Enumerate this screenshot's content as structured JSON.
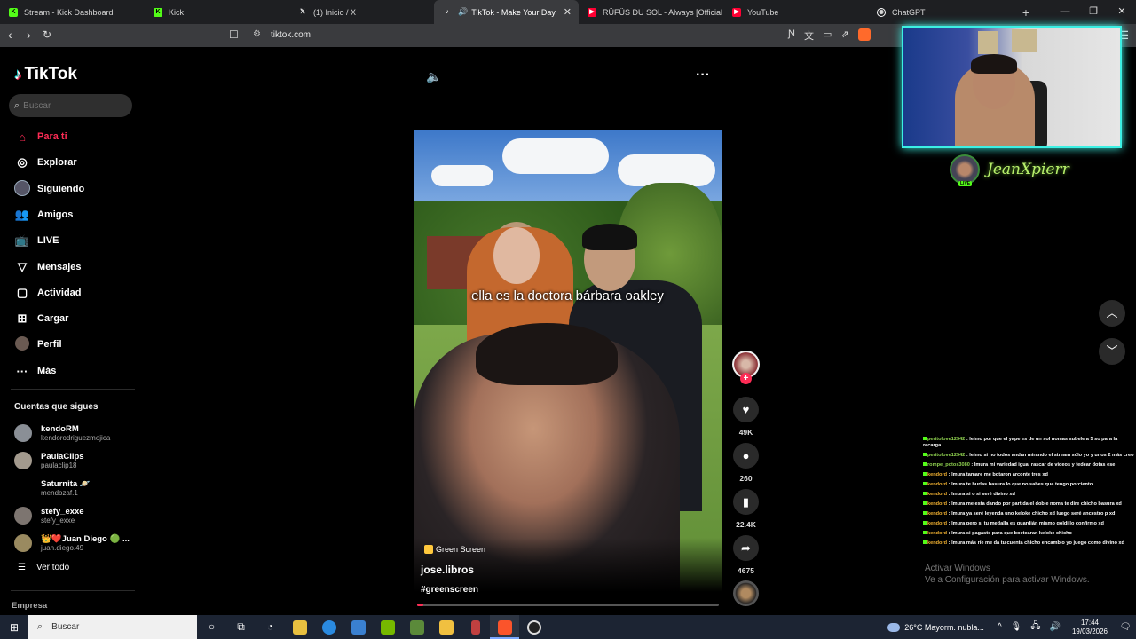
{
  "browser": {
    "tabs": [
      {
        "label": "Stream - Kick Dashboard",
        "icon": "kick-icon",
        "color": "#53fc18"
      },
      {
        "label": "Kick",
        "icon": "kick-icon",
        "color": "#53fc18"
      },
      {
        "label": "(1) Inicio / X",
        "icon": "x-icon",
        "color": "#ffffff"
      },
      {
        "label": "TikTok - Make Your Day",
        "icon": "tiktok-icon",
        "color": "#ffffff",
        "active": true
      },
      {
        "label": "RÜFÜS DU SOL - Always [Official Au",
        "icon": "youtube-icon",
        "color": "#ff0033"
      },
      {
        "label": "YouTube",
        "icon": "youtube-icon",
        "color": "#ff0033"
      },
      {
        "label": "ChatGPT",
        "icon": "chatgpt-icon",
        "color": "#ffffff"
      }
    ],
    "url": "tiktok.com"
  },
  "sidebar": {
    "brand": "TikTok",
    "search_placeholder": "Buscar",
    "nav": [
      {
        "label": "Para ti",
        "icon": "home-icon"
      },
      {
        "label": "Explorar",
        "icon": "compass-icon"
      },
      {
        "label": "Siguiendo",
        "icon": "following-icon"
      },
      {
        "label": "Amigos",
        "icon": "friends-icon"
      },
      {
        "label": "LIVE",
        "icon": "live-icon"
      },
      {
        "label": "Mensajes",
        "icon": "messages-icon"
      },
      {
        "label": "Actividad",
        "icon": "activity-icon"
      },
      {
        "label": "Cargar",
        "icon": "upload-icon"
      },
      {
        "label": "Perfil",
        "icon": "profile-icon"
      },
      {
        "label": "Más",
        "icon": "more-icon"
      }
    ],
    "following_title": "Cuentas que sigues",
    "following": [
      {
        "name": "kendoRM",
        "user": "kendorodriguezmojica"
      },
      {
        "name": "PaulaClips",
        "user": "paulaclip18"
      },
      {
        "name": "Saturnita",
        "user": "mendozaf.1"
      },
      {
        "name": "stefy_exxe",
        "user": "stefy_exxe"
      },
      {
        "name": "👑❤️Juan Diego 🟢 ...",
        "user": "juan.diego.49"
      }
    ],
    "see_all": "Ver todo",
    "company": "Empresa"
  },
  "video": {
    "caption": "ella es la doctora bárbara oakley",
    "effect_badge": "Green Screen",
    "author": "jose.libros",
    "hashtag": "#greenscreen",
    "progress": 0.02,
    "likes": "49K",
    "comments": "260",
    "saves": "22.4K",
    "shares": "4675"
  },
  "stream_overlay": {
    "streamer": "JeanXpierr",
    "live_badge": "LIVE",
    "chat": [
      {
        "user": "peritolove12542",
        "msg": "lelmo por que el yape es de un sol nomas subele a 5 so para la recarga",
        "color": "green"
      },
      {
        "user": "peritolove12542",
        "msg": "lelmo si no todos andan mirando el stream sólo yo y unos 2 más creo",
        "color": "green"
      },
      {
        "user": "rompe_potos3080",
        "msg": "lmura mi variedad igual rascar de videos y fedear dotas ese",
        "color": "green"
      },
      {
        "user": "kendord",
        "msg": "lmura tamare me botaron arconte tres xd",
        "color": "orange"
      },
      {
        "user": "kendord",
        "msg": "lmura te burlas basura lo que no sabes que tengo porciento",
        "color": "orange"
      },
      {
        "user": "kendord",
        "msg": "lmura si o si seré divino xd",
        "color": "orange"
      },
      {
        "user": "kendord",
        "msg": "lmura me esta dando por partida el doble noma te dire chicho basura xd",
        "color": "orange"
      },
      {
        "user": "kendord",
        "msg": "lmura ya seré leyenda uno keloke chicho xd luego seré ancestro p xd",
        "color": "orange"
      },
      {
        "user": "kendord",
        "msg": "lmura pero si tu medalla es guardián mismo goldi lo confirmo xd",
        "color": "orange"
      },
      {
        "user": "kendord",
        "msg": "lmura si pagaste para que boetearan keloke chicho",
        "color": "orange"
      },
      {
        "user": "kendord",
        "msg": "lmura más ríe me da tu cuenta chicho encambio yo juego como divino xd",
        "color": "orange"
      }
    ],
    "activate_line1": "Activar Windows",
    "activate_line2": "Ve a Configuración para activar Windows."
  },
  "taskbar": {
    "search_placeholder": "Buscar",
    "weather": "26°C  Mayorm. nubla...",
    "time": "17:44",
    "date": "19/03/2026"
  },
  "colors": {
    "accent": "#fe2c55",
    "kick_green": "#53fc18",
    "webcam_border": "#3cf0e4"
  }
}
